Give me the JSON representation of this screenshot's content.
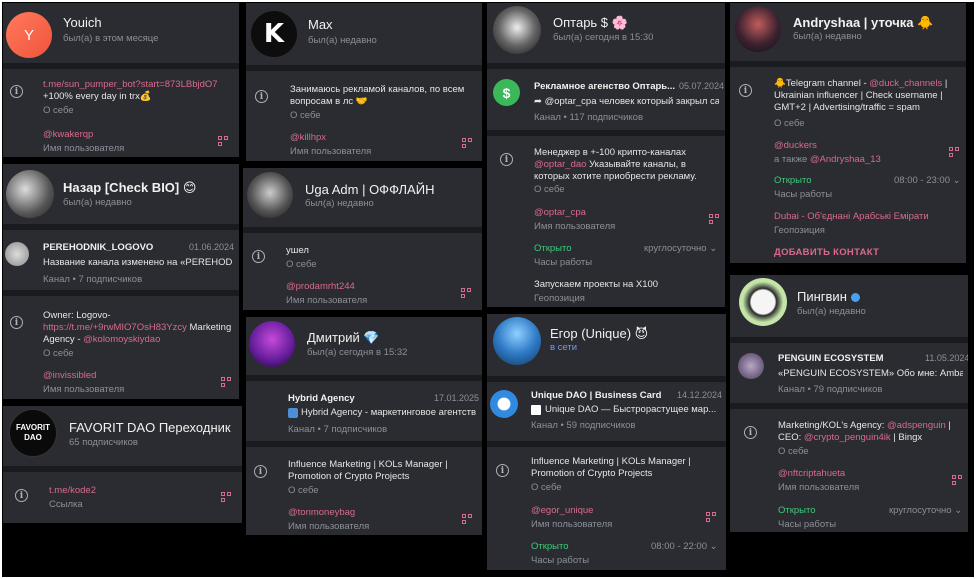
{
  "colors": {
    "card_bg": "#212227",
    "section_bg": "#2a2c31",
    "accent": "#d96a8c",
    "green": "#3ecb7a",
    "muted": "#8c8f96"
  },
  "cards": {
    "youich": {
      "name": "Youich",
      "status": "был(а) в этом месяце",
      "avatar_letter": "Y",
      "bio_link": "t.me/sun_pumper_bot?start=873LBbjdO7",
      "bio_text": "+100% every day in trx💰",
      "bio_label": "О себе",
      "username": "@kwakerqp",
      "username_label": "Имя пользователя"
    },
    "nazar": {
      "name": "Назар [Check BIO] 😊",
      "status": "был(а) недавно",
      "channel_title": "PEREHODNIK_LOGOVO",
      "channel_date": "01.06.2024",
      "channel_desc": "Название канала изменено на «PEREHODNI...",
      "channel_sub": "Канал • 7 подписчиков",
      "bio_line1": "Owner: Logovo-",
      "bio_link": "https://t.me/+9rwMIO7OsH83Yzcy",
      "bio_line2_suffix": " Marketing",
      "bio_line3_prefix": "Agency - ",
      "bio_mention": "@kolomoyskiydao",
      "bio_label": "О себе",
      "username": "@invissibled",
      "username_label": "Имя пользователя"
    },
    "favorit": {
      "name": "FAVORIT DAO Переходник",
      "status": "65 подписчиков",
      "avatar_text": "FAVORIT DAO",
      "link": "t.me/kode2",
      "link_label": "Ссылка"
    },
    "max": {
      "name": "Max",
      "status": "был(а) недавно",
      "bio_text": "Занимаюсь рекламой каналов, по всем вопросам в лс 🤝",
      "bio_label": "О себе",
      "username": "@killhpx",
      "username_label": "Имя пользователя"
    },
    "uga": {
      "name": "Uga Adm | ОФФЛАЙН",
      "status": "был(а) недавно",
      "bio_text": "ушел",
      "bio_label": "О себе",
      "username": "@prodamrht244",
      "username_label": "Имя пользователя"
    },
    "dmitry": {
      "name": "Дмитрий 💎",
      "status": "был(а) сегодня в 15:32",
      "channel_title": "Hybrid Agency",
      "channel_date": "17.01.2025",
      "channel_desc": "Hybrid Agency - маркетинговое агентств...",
      "channel_sub": "Канал • 7 подписчиков",
      "bio_text": "Influence Marketing | KOLs Manager | Promotion of Crypto Projects",
      "bio_label": "О себе",
      "username": "@tonmoneybag",
      "username_label": "Имя пользователя"
    },
    "optar": {
      "name": "Оптарь $ 🌸",
      "status": "был(а) сегодня в 15:30",
      "channel_title": "Рекламное агенство Оптарь...",
      "channel_date": "05.07.2024",
      "channel_desc": "➦ @optar_cpa человек который закрыл сам...",
      "channel_sub": "Канал • 117 подписчиков",
      "bio_line1": "Менеджер в +-100 крипто-каналах",
      "bio_mention": "@optar_dao",
      "bio_line2_suffix": " Указывайте каналы, в которых хотите приобрести рекламу.",
      "bio_label": "О себе",
      "username": "@optar_cpa",
      "username_label": "Имя пользователя",
      "hours_status": "Открыто",
      "hours_value": "круглосуточно",
      "hours_label": "Часы работы",
      "location": "Запускаем проекты на Х100",
      "location_label": "Геопозиция"
    },
    "egor": {
      "name": "Егор (Unique) 😈",
      "status": "в сети",
      "channel_title": "Unique DAO | Business Card",
      "channel_date": "14.12.2024",
      "channel_desc": "Unique DAO — Быстрорастущее мар...",
      "channel_sub": "Канал • 59 подписчиков",
      "bio_text": "Influence Marketing | KOLs Manager | Promotion of Crypto Projects",
      "bio_label": "О себе",
      "username": "@egor_unique",
      "username_label": "Имя пользователя",
      "hours_status": "Открыто",
      "hours_value": "08:00 - 22:00",
      "hours_label": "Часы работы"
    },
    "andryshaa": {
      "name": "Andryshaa | уточка 🐥",
      "status": "был(а) недавно",
      "bio_prefix": "🐥Telegram channel - ",
      "bio_mention": "@duck_channels",
      "bio_rest": " | Ukrainian influencer | Check username | GMT+2 | Advertising/traffic = spam",
      "bio_label": "О себе",
      "username": "@duckers",
      "username_also_prefix": "а также ",
      "username_also": "@Andryshaa_13",
      "hours_status": "Открыто",
      "hours_value": "08:00 - 23:00",
      "hours_label": "Часы работы",
      "location": "Dubai - Об'єднані Арабські Емірати",
      "location_label": "Геопозиция",
      "add_contact": "ДОБАВИТЬ КОНТАКТ"
    },
    "penguin": {
      "name": "Пингвин",
      "status": "был(а) недавно",
      "channel_title": "PENGUIN ECOSYSTEM",
      "channel_date": "11.05.2024",
      "channel_desc": "«PENGUIN ECOSYSTEM»   Обо мне: Ambass...",
      "channel_sub": "Канал • 79 подписчиков",
      "bio_prefix": "Marketing/KOL's Agency: ",
      "bio_mention1": "@adspenguin",
      "bio_mid": " | CEO: ",
      "bio_mention2": "@crypto_penguin4ik",
      "bio_suffix": " | Bingx",
      "bio_label": "О себе",
      "username": "@nftcriptahueta",
      "username_label": "Имя пользователя",
      "hours_status": "Открыто",
      "hours_value": "круглосуточно",
      "hours_label": "Часы работы"
    }
  }
}
